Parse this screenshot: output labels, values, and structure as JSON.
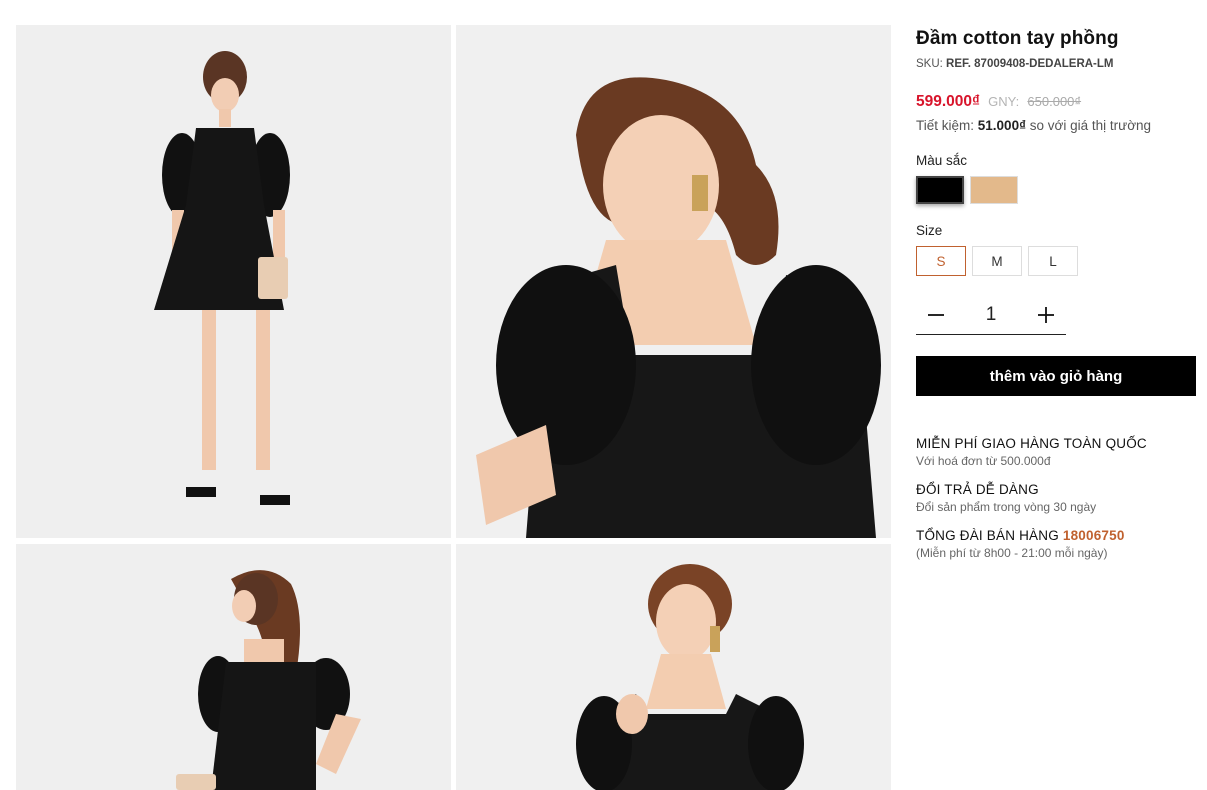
{
  "product": {
    "title": "Đầm cotton tay phồng",
    "sku_label": "SKU:",
    "sku": "REF. 87009408-DEDALERA-LM",
    "price": "599.000₫",
    "gny_label": "GNY:",
    "old_price": "650.000₫",
    "save_prefix": "Tiết kiệm:",
    "save_amount": "51.000₫",
    "save_suffix": "so với giá thị trường"
  },
  "color": {
    "label": "Màu sắc",
    "options": [
      {
        "name": "black",
        "hex": "#000000"
      },
      {
        "name": "beige",
        "hex": "#e3b98b"
      }
    ],
    "selected": "black"
  },
  "size": {
    "label": "Size",
    "options": [
      "S",
      "M",
      "L"
    ],
    "selected": "S"
  },
  "quantity": {
    "minus": "−",
    "value": "1",
    "plus": "+"
  },
  "cart_button": "thêm vào giỏ hàng",
  "perks": {
    "shipping_title": "MIỄN PHÍ GIAO HÀNG TOÀN QUỐC",
    "shipping_sub": "Với hoá đơn từ 500.000đ",
    "return_title": "ĐỔI TRẢ DỄ DÀNG",
    "return_sub": "Đổi sản phẩm trong vòng 30 ngày",
    "hotline_title": "TỔNG ĐÀI BÁN HÀNG",
    "hotline_number": "18006750",
    "hotline_sub": "(Miễn phí từ 8h00 - 21:00 mỗi ngày)"
  },
  "colors": {
    "price_red": "#d8142b",
    "accent_orange": "#c0612f",
    "button_black": "#000000"
  }
}
